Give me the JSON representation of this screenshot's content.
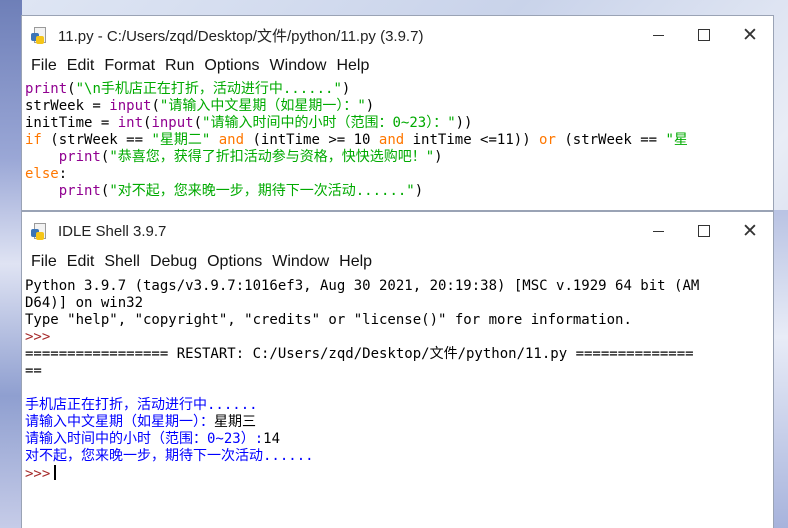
{
  "editor": {
    "title": "11.py - C:/Users/zqd/Desktop/文件/python/11.py (3.9.7)",
    "menu": [
      "File",
      "Edit",
      "Format",
      "Run",
      "Options",
      "Window",
      "Help"
    ],
    "code": {
      "l1_fn": "print",
      "l1_str": "\"\\n手机店正在打折，活动进行中......\"",
      "l1_close": ")",
      "l2_var": "strWeek = ",
      "l2_fn": "input",
      "l2_str": "\"请输入中文星期（如星期一）：\"",
      "l2_close": ")",
      "l3_var": "initTime = ",
      "l3_fn1": "int",
      "l3_paren": "(",
      "l3_fn2": "input",
      "l3_str": "\"请输入时间中的小时（范围：0~23）：\"",
      "l3_close": "))",
      "l4_kw_if": "if",
      "l4_a": " (strWeek == ",
      "l4_str1": "\"星期二\"",
      "l4_kw_and1": "and",
      "l4_b": " (intTime >= 10 ",
      "l4_kw_and2": "and",
      "l4_c": " intTime <=11)) ",
      "l4_kw_or": "or",
      "l4_d": " (strWeek == ",
      "l4_str2": "\"星",
      "l5_indent": "    ",
      "l5_fn": "print",
      "l5_str": "\"恭喜您，获得了折扣活动参与资格，快快选购吧！\"",
      "l5_close": ")",
      "l6_kw": "else",
      "l6_colon": ":",
      "l7_indent": "    ",
      "l7_fn": "print",
      "l7_str": "\"对不起，您来晚一步，期待下一次活动......\"",
      "l7_close": ")"
    }
  },
  "shell": {
    "title": "IDLE Shell 3.9.7",
    "menu": [
      "File",
      "Edit",
      "Shell",
      "Debug",
      "Options",
      "Window",
      "Help"
    ],
    "banner1": "Python 3.9.7 (tags/v3.9.7:1016ef3, Aug 30 2021, 20:19:38) [MSC v.1929 64 bit (AM",
    "banner2": "D64)] on win32",
    "banner3": "Type \"help\", \"copyright\", \"credits\" or \"license()\" for more information.",
    "prompt": ">>>",
    "restart1": "================= RESTART: C:/Users/zqd/Desktop/文件/python/11.py ==============",
    "restart2": "==",
    "out1": "手机店正在打折，活动进行中......",
    "out2_prompt": "请输入中文星期（如星期一）：",
    "out2_input": "星期三",
    "out3_prompt": "请输入时间中的小时（范围：0~23）:",
    "out3_input": "14",
    "out4": "对不起，您来晚一步，期待下一次活动......"
  },
  "colors": {
    "keyword": "#ff7700",
    "builtin": "#900090",
    "string": "#00aa00",
    "stdout": "#0000ff",
    "prompt": "#a52a2a"
  },
  "icons": [
    "python-file-icon",
    "minimize-icon",
    "maximize-icon",
    "close-icon"
  ]
}
